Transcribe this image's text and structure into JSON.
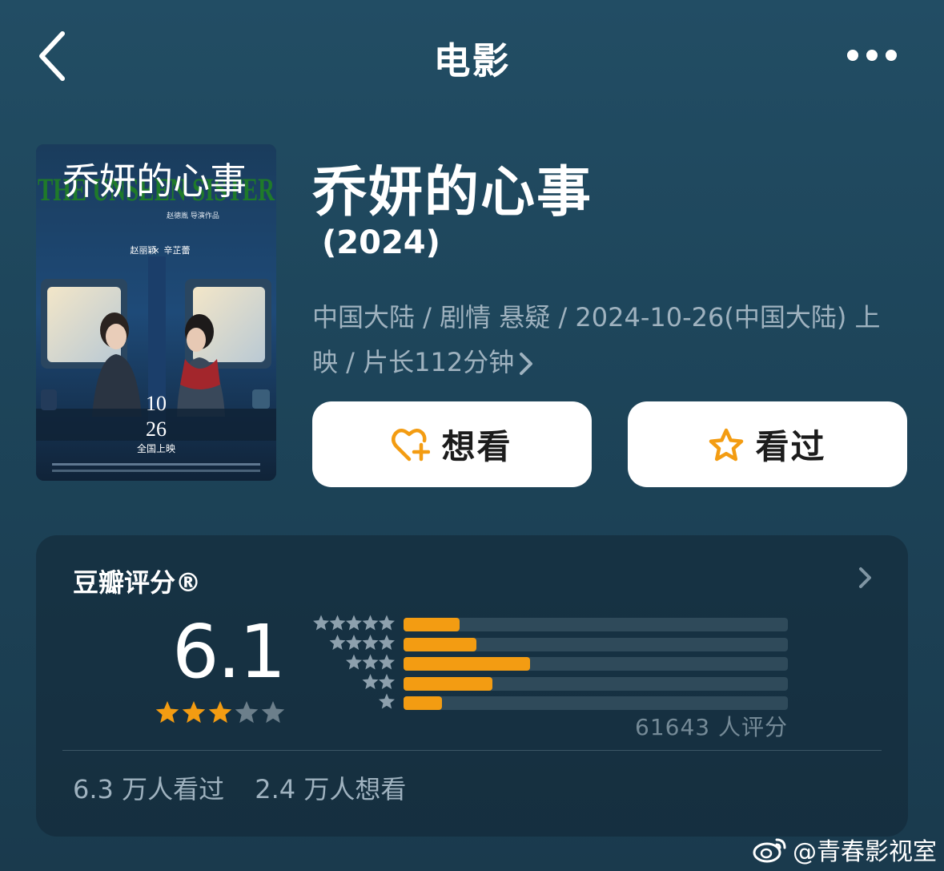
{
  "nav": {
    "title": "电影"
  },
  "movie": {
    "title": "乔妍的心事",
    "year": "(2024)",
    "meta_line": "中国大陆 / 剧情 悬疑 / 2024-10-26(中国大陆) 上映 / 片长112分钟"
  },
  "poster": {
    "title_cn": "乔妍的心事",
    "title_en": "THE UNSEEN SISTER",
    "director_line": "赵德胤 导演作品",
    "cast_left": "赵丽颖",
    "cast_right": "辛芷蕾",
    "date_month": "10",
    "date_day": "26",
    "release_text": "全国上映"
  },
  "actions": {
    "want_label": "想看",
    "seen_label": "看过"
  },
  "rating": {
    "label": "豆瓣评分®",
    "score": "6.1",
    "score_stars": 3,
    "count_text": "61643 人评分",
    "distribution": [
      {
        "stars": 5,
        "fraction": 0.145
      },
      {
        "stars": 4,
        "fraction": 0.19
      },
      {
        "stars": 3,
        "fraction": 0.33
      },
      {
        "stars": 2,
        "fraction": 0.232
      },
      {
        "stars": 1,
        "fraction": 0.1
      }
    ],
    "seen_text": "6.3 万人看过",
    "want_text": "2.4 万人想看"
  },
  "watermark": {
    "text": "@青春影视室"
  },
  "colors": {
    "accent": "#f39c12",
    "background": "#1f4a60",
    "muted": "#9fb2bf"
  }
}
